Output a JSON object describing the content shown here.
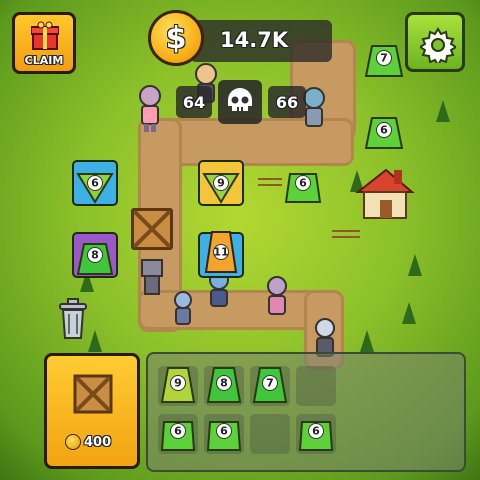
{
  "hud": {
    "claim_label": "CLAIM",
    "coins": "14.7K",
    "kills_left": "64",
    "kills_right": "66"
  },
  "board": {
    "towers": [
      {
        "id": "t1",
        "level": "6",
        "color": "#8bd439",
        "slot": "blue"
      },
      {
        "id": "t2",
        "level": "9",
        "color": "#9bd43a",
        "slot": "yellow"
      },
      {
        "id": "t3",
        "level": "6",
        "color": "#5cd13a",
        "slot": "none"
      },
      {
        "id": "t4",
        "level": "8",
        "color": "#3fc63a",
        "slot": "purple"
      },
      {
        "id": "t5",
        "level": "11",
        "color": "#f3a42b",
        "slot": "blue"
      },
      {
        "id": "t6",
        "level": "7",
        "color": "#5cd13a",
        "slot": "none"
      },
      {
        "id": "t7",
        "level": "6",
        "color": "#5cd13a",
        "slot": "none"
      }
    ]
  },
  "shop": {
    "crate_price": "400"
  },
  "inventory": {
    "items": [
      {
        "level": "9",
        "color": "#b0d43a"
      },
      {
        "level": "8",
        "color": "#3fc63a"
      },
      {
        "level": "7",
        "color": "#3fc63a"
      },
      {
        "level": "6",
        "color": "#5cd13a"
      },
      {
        "level": "6",
        "color": "#5cd13a"
      },
      {
        "level": "6",
        "color": "#5cd13a"
      }
    ]
  },
  "colors": {
    "coin": "#f5a90f",
    "claim_button": "#ffc92b",
    "settings_button": "#8fd432",
    "path": "#c79a62"
  },
  "icons": {
    "claim": "gift-icon",
    "currency": "coin-icon",
    "settings": "gear-icon",
    "kills": "skull-icon",
    "delete": "trash-icon",
    "crate": "crate-icon"
  }
}
